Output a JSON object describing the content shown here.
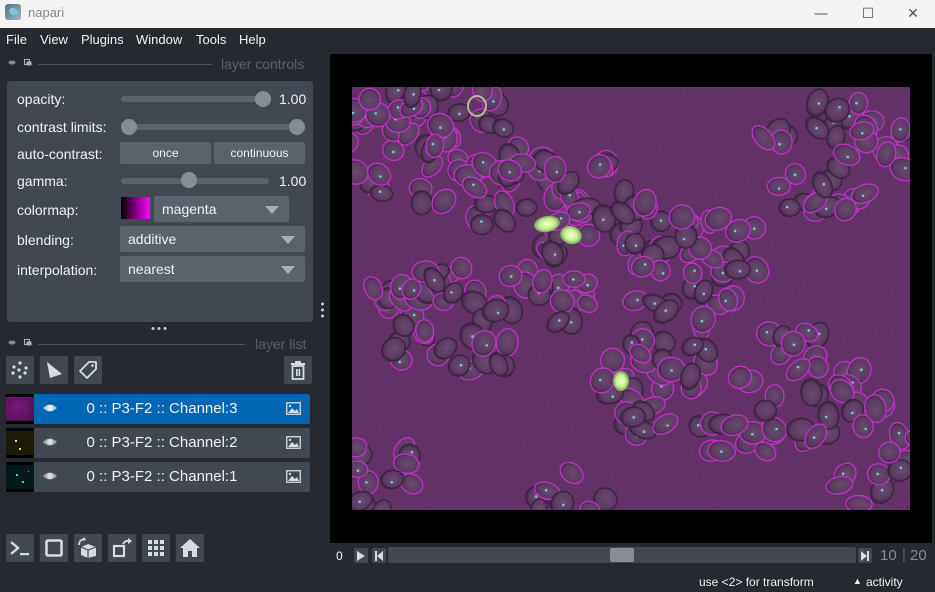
{
  "window": {
    "title": "napari",
    "minimize_glyph": "—",
    "maximize_glyph": "☐",
    "close_glyph": "✕"
  },
  "menu": [
    "File",
    "View",
    "Plugins",
    "Window",
    "Tools",
    "Help"
  ],
  "layer_controls": {
    "header": "layer controls",
    "opacity": {
      "label": "opacity:",
      "value": "1.00",
      "fraction": 1.0
    },
    "contrast_limits": {
      "label": "contrast limits:",
      "low_fraction": 0.0,
      "high_fraction": 1.0
    },
    "auto_contrast": {
      "label": "auto-contrast:",
      "once": "once",
      "continuous": "continuous"
    },
    "gamma": {
      "label": "gamma:",
      "value": "1.00",
      "fraction": 0.45
    },
    "colormap": {
      "label": "colormap:",
      "value": "magenta",
      "swatch_color": "#ff00ff"
    },
    "blending": {
      "label": "blending:",
      "value": "additive"
    },
    "interpolation": {
      "label": "interpolation:",
      "value": "nearest"
    }
  },
  "layer_list": {
    "header": "layer list",
    "tools": [
      "new-points-layer",
      "new-shapes-layer",
      "new-labels-layer",
      "delete-layer"
    ],
    "layers": [
      {
        "name": "0 :: P3-F2 :: Channel:3",
        "visible": true,
        "selected": true,
        "color": "#b020b0"
      },
      {
        "name": "0 :: P3-F2 :: Channel:2",
        "visible": true,
        "selected": false,
        "color": "#c8c820"
      },
      {
        "name": "0 :: P3-F2 :: Channel:1",
        "visible": true,
        "selected": false,
        "color": "#20b0b0"
      }
    ]
  },
  "viewer_buttons": [
    "console",
    "ndisplay-2d-3d",
    "roll-dimensions",
    "transpose-dimensions",
    "grid-view",
    "reset-view"
  ],
  "dims": {
    "axis_label": "0",
    "current": "10",
    "total": "20",
    "position_fraction": 0.5
  },
  "status": {
    "hint": "use <2> for transform",
    "activity": "activity",
    "activity_glyph": "▲"
  },
  "colors": {
    "background": "#262930",
    "panel": "#414851",
    "control": "#5a626c",
    "accent": "#0066b3",
    "text": "#f0f1f2"
  }
}
